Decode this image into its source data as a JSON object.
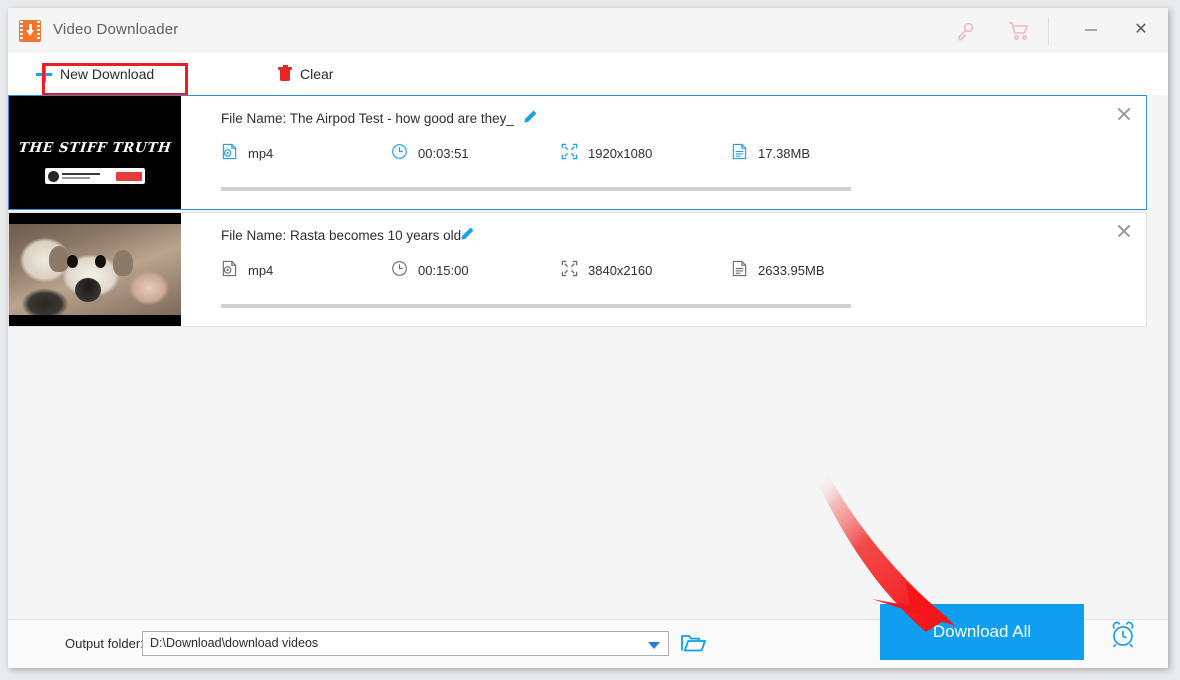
{
  "window": {
    "title": "Video Downloader",
    "app_icon": "video-download-icon",
    "titlebar_icons": [
      {
        "name": "key-icon",
        "label": "Register"
      },
      {
        "name": "cart-icon",
        "label": "Buy"
      }
    ],
    "controls": [
      {
        "name": "minimize-button",
        "glyph": "–"
      },
      {
        "name": "close-button",
        "glyph": "✕"
      }
    ]
  },
  "toolbar": {
    "new_download_label": "New Download",
    "clear_label": "Clear",
    "highlight_color": "#ee1c25"
  },
  "colors": {
    "accent_blue": "#1f9fe8",
    "button_blue": "#0f9ef0",
    "selected_border": "#2d8fd5",
    "annotation_red": "#f5232a",
    "app_orange": "#f2762e"
  },
  "downloads": [
    {
      "selected": true,
      "filename_label": "File Name:",
      "filename": "The Airpod Test - how good are they_",
      "edit_icon": "pencil-icon",
      "format": "mp4",
      "duration": "00:03:51",
      "resolution": "1920x1080",
      "size": "17.38MB",
      "progress_percent": 0,
      "thumbnail": {
        "type": "title-card",
        "title": "THE STIFF TRUTH",
        "subscribe_label": ""
      }
    },
    {
      "selected": false,
      "filename_label": "File Name:",
      "filename": "Rasta becomes 10 years old",
      "edit_icon": "pencil-icon",
      "format": "mp4",
      "duration": "00:15:00",
      "resolution": "3840x2160",
      "size": "2633.95MB",
      "progress_percent": 0,
      "thumbnail": {
        "type": "photo",
        "title": "",
        "subscribe_label": ""
      }
    }
  ],
  "footer": {
    "output_folder_label": "Output folder:",
    "output_folder_value": "D:\\Download\\download videos",
    "browse_icon": "folder-icon",
    "download_all_label": "Download All",
    "schedule_icon": "alarm-clock-icon"
  }
}
